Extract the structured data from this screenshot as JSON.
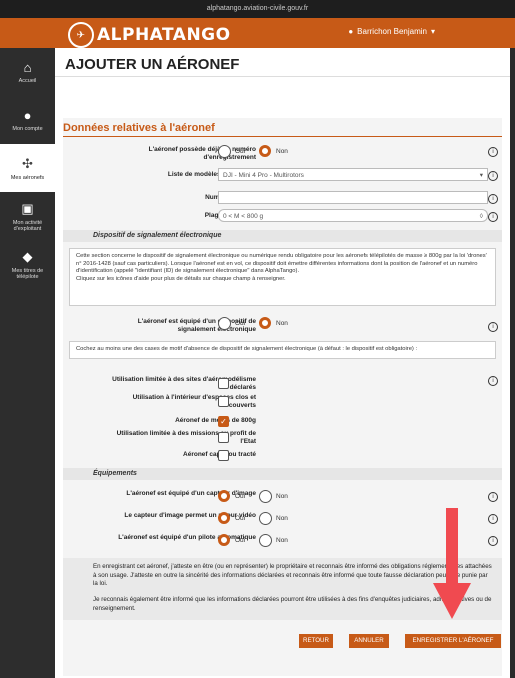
{
  "url": "alphatango.aviation-civile.gouv.fr",
  "app": {
    "logo": "ALPHATANGO"
  },
  "user": {
    "name": "Barrichon Benjamin"
  },
  "sidebar": {
    "items": [
      {
        "label": "Accueil",
        "icon": "home-icon",
        "glyph": "⌂"
      },
      {
        "label": "Mon compte",
        "icon": "user-icon",
        "glyph": "●"
      },
      {
        "label": "Mes aéronefs",
        "icon": "drone-icon",
        "glyph": "✣"
      },
      {
        "label": "Mon activité d'exploitant",
        "icon": "briefcase-icon",
        "glyph": "▣"
      },
      {
        "label": "Mes titres de télépilote",
        "icon": "graduation-cap-icon",
        "glyph": "◆"
      }
    ]
  },
  "page": {
    "title": "AJOUTER UN AÉRONEF"
  },
  "section1": {
    "title": "Données relatives à l'aéronef",
    "registration": {
      "label": "L'aéronef possède déjà un numéro d'enregistrement",
      "oui": "Oui",
      "non": "Non",
      "selected": "Non"
    },
    "model": {
      "label": "Liste de modèles prédéfinis*",
      "value": "DJI - Mini 4 Pro - Multirotors"
    },
    "serial": {
      "label": "Numéro de série",
      "value": ""
    },
    "mass": {
      "label": "Plage de masse*",
      "value": "0 < M < 800 g"
    }
  },
  "signal": {
    "band": "Dispositif de signalement électronique",
    "description": "Cette section concerne le dispositif de signalement électronique ou numérique rendu obligatoire pour les aéronefs télépilotés de masse ≥ 800g par la loi 'drones' n° 2016-1428 (sauf cas particuliers). Lorsque l'aéronef est en vol, ce dispositif doit émettre différentes informations dont la position de l'aéronef et un numéro d'identification (appelé \"identifiant (ID) de signalement électronique\" dans AlphaTango).",
    "help": "Cliquez sur les icônes d'aide pour plus de détails sur chaque champ à renseigner.",
    "equipped": {
      "label": "L'aéronef est équipé d'un dispositif de signalement électronique",
      "oui": "Oui",
      "non": "Non",
      "selected": "Non"
    },
    "instruction": "Cochez au moins une des cases de motif d'absence de dispositif de signalement électronique (à défaut : le dispositif est obligatoire) :",
    "reasons": [
      {
        "label": "Utilisation limitée à des sites d'aéromodélisme déclarés",
        "checked": false
      },
      {
        "label": "Utilisation à l'intérieur d'espaces clos et couverts",
        "checked": false
      },
      {
        "label": "Aéronef de moins de 800g",
        "checked": true
      },
      {
        "label": "Utilisation limitée à des missions au profit de l'Etat",
        "checked": false
      },
      {
        "label": "Aéronef captif ou tracté",
        "checked": false
      }
    ]
  },
  "equipment": {
    "band": "Équipements",
    "items": [
      {
        "label": "L'aéronef est équipé d'un capteur d'image",
        "oui": "Oui",
        "non": "Non",
        "selected": "Oui"
      },
      {
        "label": "Le capteur d'image permet un retour vidéo",
        "oui": "Oui",
        "non": "Non",
        "selected": "Oui"
      },
      {
        "label": "L'aéronef est équipé d'un pilote automatique",
        "oui": "Oui",
        "non": "Non",
        "selected": "Oui"
      }
    ]
  },
  "consent": {
    "p1": "En enregistrant cet aéronef, j'atteste en être (ou en représenter) le propriétaire et reconnais être informé des obligations réglementaires attachées à son usage. J'atteste en outre la sincérité des informations déclarées et reconnais être informé que toute fausse déclaration peut être punie par la loi.",
    "p2": "Je reconnais également être informé que les informations déclarées pourront être utilisées à des fins d'enquêtes judiciaires, administratives ou de renseignement."
  },
  "buttons": {
    "back": "RETOUR",
    "cancel": "ANNULER",
    "save": "ENREGISTRER L'AÉRONEF"
  },
  "colors": {
    "brand": "#c75a17",
    "arrow": "#f04a50"
  }
}
